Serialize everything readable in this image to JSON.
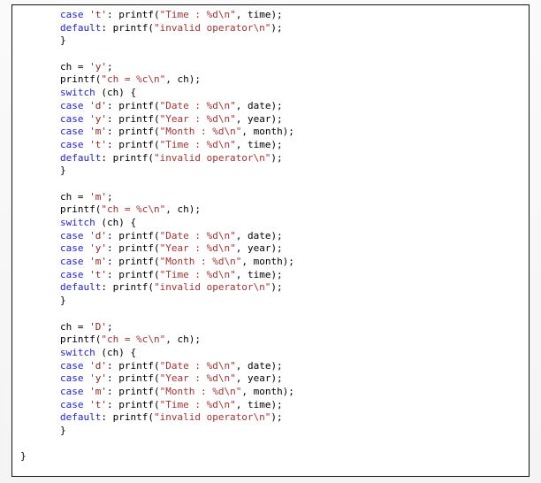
{
  "code_box": {
    "language": "c",
    "colors": {
      "keyword": "#2222cc",
      "string": "#a33333",
      "char_literal": "#882222",
      "plain": "#000000",
      "background": "#ffffff",
      "border": "#111111",
      "page_background": "#f7f7f7"
    },
    "lines": [
      {
        "indent": "inner",
        "tokens": [
          {
            "t": "kw",
            "v": "case"
          },
          {
            "t": "pun",
            "v": " "
          },
          {
            "t": "char",
            "v": "'t'"
          },
          {
            "t": "pun",
            "v": ": printf("
          },
          {
            "t": "str",
            "v": "\"Time : %d\\n\""
          },
          {
            "t": "pun",
            "v": ", time);"
          }
        ]
      },
      {
        "indent": "inner",
        "tokens": [
          {
            "t": "kw",
            "v": "default"
          },
          {
            "t": "pun",
            "v": ": printf("
          },
          {
            "t": "str",
            "v": "\"invalid operator\\n\""
          },
          {
            "t": "pun",
            "v": ");"
          }
        ]
      },
      {
        "indent": "inner",
        "tokens": [
          {
            "t": "pun",
            "v": "}"
          }
        ]
      },
      {
        "indent": "inner",
        "tokens": []
      },
      {
        "indent": "inner",
        "tokens": [
          {
            "t": "pun",
            "v": "ch = "
          },
          {
            "t": "char",
            "v": "'y'"
          },
          {
            "t": "pun",
            "v": ";"
          }
        ]
      },
      {
        "indent": "inner",
        "tokens": [
          {
            "t": "pun",
            "v": "printf("
          },
          {
            "t": "str",
            "v": "\"ch = %c\\n\""
          },
          {
            "t": "pun",
            "v": ", ch);"
          }
        ]
      },
      {
        "indent": "inner",
        "tokens": [
          {
            "t": "kw",
            "v": "switch"
          },
          {
            "t": "pun",
            "v": " (ch) {"
          }
        ]
      },
      {
        "indent": "inner",
        "tokens": [
          {
            "t": "kw",
            "v": "case"
          },
          {
            "t": "pun",
            "v": " "
          },
          {
            "t": "char",
            "v": "'d'"
          },
          {
            "t": "pun",
            "v": ": printf("
          },
          {
            "t": "str",
            "v": "\"Date : %d\\n\""
          },
          {
            "t": "pun",
            "v": ", date);"
          }
        ]
      },
      {
        "indent": "inner",
        "tokens": [
          {
            "t": "kw",
            "v": "case"
          },
          {
            "t": "pun",
            "v": " "
          },
          {
            "t": "char",
            "v": "'y'"
          },
          {
            "t": "pun",
            "v": ": printf("
          },
          {
            "t": "str",
            "v": "\"Year : %d\\n\""
          },
          {
            "t": "pun",
            "v": ", year);"
          }
        ]
      },
      {
        "indent": "inner",
        "tokens": [
          {
            "t": "kw",
            "v": "case"
          },
          {
            "t": "pun",
            "v": " "
          },
          {
            "t": "char",
            "v": "'m'"
          },
          {
            "t": "pun",
            "v": ": printf("
          },
          {
            "t": "str",
            "v": "\"Month : %d\\n\""
          },
          {
            "t": "pun",
            "v": ", month);"
          }
        ]
      },
      {
        "indent": "inner",
        "tokens": [
          {
            "t": "kw",
            "v": "case"
          },
          {
            "t": "pun",
            "v": " "
          },
          {
            "t": "char",
            "v": "'t'"
          },
          {
            "t": "pun",
            "v": ": printf("
          },
          {
            "t": "str",
            "v": "\"Time : %d\\n\""
          },
          {
            "t": "pun",
            "v": ", time);"
          }
        ]
      },
      {
        "indent": "inner",
        "tokens": [
          {
            "t": "kw",
            "v": "default"
          },
          {
            "t": "pun",
            "v": ": printf("
          },
          {
            "t": "str",
            "v": "\"invalid operator\\n\""
          },
          {
            "t": "pun",
            "v": ");"
          }
        ]
      },
      {
        "indent": "inner",
        "tokens": [
          {
            "t": "pun",
            "v": "}"
          }
        ]
      },
      {
        "indent": "inner",
        "tokens": []
      },
      {
        "indent": "inner",
        "tokens": [
          {
            "t": "pun",
            "v": "ch = "
          },
          {
            "t": "char",
            "v": "'m'"
          },
          {
            "t": "pun",
            "v": ";"
          }
        ]
      },
      {
        "indent": "inner",
        "tokens": [
          {
            "t": "pun",
            "v": "printf("
          },
          {
            "t": "str",
            "v": "\"ch = %c\\n\""
          },
          {
            "t": "pun",
            "v": ", ch);"
          }
        ]
      },
      {
        "indent": "inner",
        "tokens": [
          {
            "t": "kw",
            "v": "switch"
          },
          {
            "t": "pun",
            "v": " (ch) {"
          }
        ]
      },
      {
        "indent": "inner",
        "tokens": [
          {
            "t": "kw",
            "v": "case"
          },
          {
            "t": "pun",
            "v": " "
          },
          {
            "t": "char",
            "v": "'d'"
          },
          {
            "t": "pun",
            "v": ": printf("
          },
          {
            "t": "str",
            "v": "\"Date : %d\\n\""
          },
          {
            "t": "pun",
            "v": ", date);"
          }
        ]
      },
      {
        "indent": "inner",
        "tokens": [
          {
            "t": "kw",
            "v": "case"
          },
          {
            "t": "pun",
            "v": " "
          },
          {
            "t": "char",
            "v": "'y'"
          },
          {
            "t": "pun",
            "v": ": printf("
          },
          {
            "t": "str",
            "v": "\"Year : %d\\n\""
          },
          {
            "t": "pun",
            "v": ", year);"
          }
        ]
      },
      {
        "indent": "inner",
        "tokens": [
          {
            "t": "kw",
            "v": "case"
          },
          {
            "t": "pun",
            "v": " "
          },
          {
            "t": "char",
            "v": "'m'"
          },
          {
            "t": "pun",
            "v": ": printf("
          },
          {
            "t": "str",
            "v": "\"Month : %d\\n\""
          },
          {
            "t": "pun",
            "v": ", month);"
          }
        ]
      },
      {
        "indent": "inner",
        "tokens": [
          {
            "t": "kw",
            "v": "case"
          },
          {
            "t": "pun",
            "v": " "
          },
          {
            "t": "char",
            "v": "'t'"
          },
          {
            "t": "pun",
            "v": ": printf("
          },
          {
            "t": "str",
            "v": "\"Time : %d\\n\""
          },
          {
            "t": "pun",
            "v": ", time);"
          }
        ]
      },
      {
        "indent": "inner",
        "tokens": [
          {
            "t": "kw",
            "v": "default"
          },
          {
            "t": "pun",
            "v": ": printf("
          },
          {
            "t": "str",
            "v": "\"invalid operator\\n\""
          },
          {
            "t": "pun",
            "v": ");"
          }
        ]
      },
      {
        "indent": "inner",
        "tokens": [
          {
            "t": "pun",
            "v": "}"
          }
        ]
      },
      {
        "indent": "inner",
        "tokens": []
      },
      {
        "indent": "inner",
        "tokens": [
          {
            "t": "pun",
            "v": "ch = "
          },
          {
            "t": "char",
            "v": "'D'"
          },
          {
            "t": "pun",
            "v": ";"
          }
        ]
      },
      {
        "indent": "inner",
        "tokens": [
          {
            "t": "pun",
            "v": "printf("
          },
          {
            "t": "str",
            "v": "\"ch = %c\\n\""
          },
          {
            "t": "pun",
            "v": ", ch);"
          }
        ]
      },
      {
        "indent": "inner",
        "tokens": [
          {
            "t": "kw",
            "v": "switch"
          },
          {
            "t": "pun",
            "v": " (ch) {"
          }
        ]
      },
      {
        "indent": "inner",
        "tokens": [
          {
            "t": "kw",
            "v": "case"
          },
          {
            "t": "pun",
            "v": " "
          },
          {
            "t": "char",
            "v": "'d'"
          },
          {
            "t": "pun",
            "v": ": printf("
          },
          {
            "t": "str",
            "v": "\"Date : %d\\n\""
          },
          {
            "t": "pun",
            "v": ", date);"
          }
        ]
      },
      {
        "indent": "inner",
        "tokens": [
          {
            "t": "kw",
            "v": "case"
          },
          {
            "t": "pun",
            "v": " "
          },
          {
            "t": "char",
            "v": "'y'"
          },
          {
            "t": "pun",
            "v": ": printf("
          },
          {
            "t": "str",
            "v": "\"Year : %d\\n\""
          },
          {
            "t": "pun",
            "v": ", year);"
          }
        ]
      },
      {
        "indent": "inner",
        "tokens": [
          {
            "t": "kw",
            "v": "case"
          },
          {
            "t": "pun",
            "v": " "
          },
          {
            "t": "char",
            "v": "'m'"
          },
          {
            "t": "pun",
            "v": ": printf("
          },
          {
            "t": "str",
            "v": "\"Month : %d\\n\""
          },
          {
            "t": "pun",
            "v": ", month);"
          }
        ]
      },
      {
        "indent": "inner",
        "tokens": [
          {
            "t": "kw",
            "v": "case"
          },
          {
            "t": "pun",
            "v": " "
          },
          {
            "t": "char",
            "v": "'t'"
          },
          {
            "t": "pun",
            "v": ": printf("
          },
          {
            "t": "str",
            "v": "\"Time : %d\\n\""
          },
          {
            "t": "pun",
            "v": ", time);"
          }
        ]
      },
      {
        "indent": "inner",
        "tokens": [
          {
            "t": "kw",
            "v": "default"
          },
          {
            "t": "pun",
            "v": ": printf("
          },
          {
            "t": "str",
            "v": "\"invalid operator\\n\""
          },
          {
            "t": "pun",
            "v": ");"
          }
        ]
      },
      {
        "indent": "inner",
        "tokens": [
          {
            "t": "pun",
            "v": "}"
          }
        ]
      },
      {
        "indent": "inner",
        "tokens": []
      },
      {
        "indent": "outer",
        "tokens": [
          {
            "t": "pun",
            "v": "}"
          }
        ]
      }
    ]
  }
}
